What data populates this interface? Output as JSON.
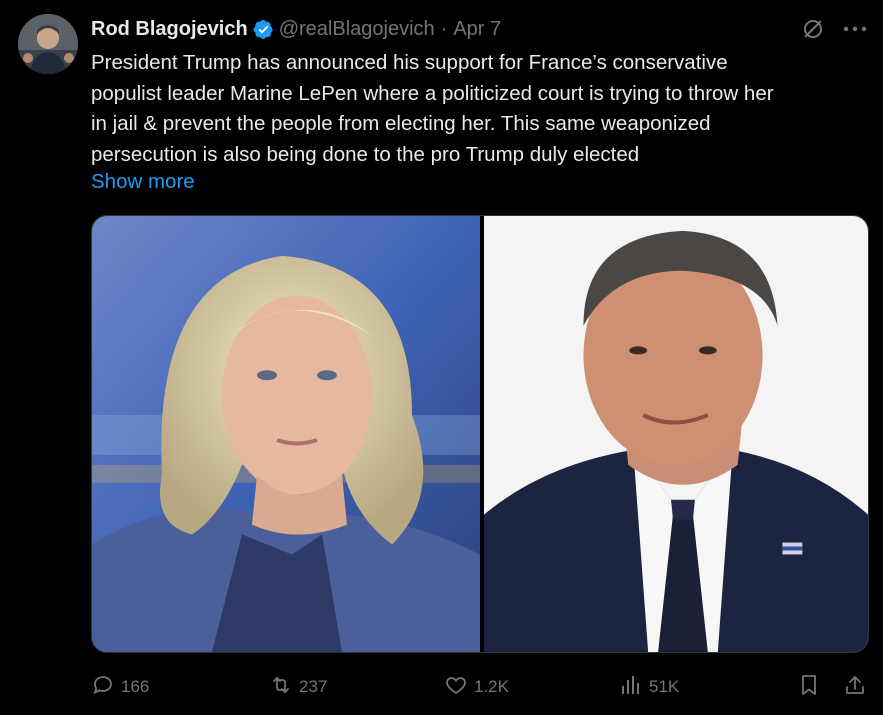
{
  "author": {
    "name": "Rod Blagojevich",
    "handle": "@realBlagojevich",
    "date": "Apr 7",
    "verified": true
  },
  "tweet": {
    "lines": [
      "President Trump has announced his support for France’s conservative",
      "populist leader Marine LePen where a politicized court is trying to throw her",
      "in jail & prevent the people from electing her. This same weaponized",
      "persecution is also being done to the pro Trump duly elected"
    ],
    "show_more": "Show more"
  },
  "separator": "·",
  "icons": {
    "verified": "verified-badge-icon",
    "grok": "grok-icon",
    "more": "more-options-icon",
    "reply": "reply-icon",
    "repost": "repost-icon",
    "like": "like-icon",
    "views": "views-icon",
    "bookmark": "bookmark-icon",
    "share": "share-icon"
  },
  "metrics": {
    "replies": "166",
    "reposts": "237",
    "likes": "1.2K",
    "views": "51K"
  },
  "colors": {
    "background": "#000000",
    "text": "#e7e9ea",
    "secondary": "#71767b",
    "link": "#1d9bf0",
    "verified": "#1d9bf0"
  }
}
